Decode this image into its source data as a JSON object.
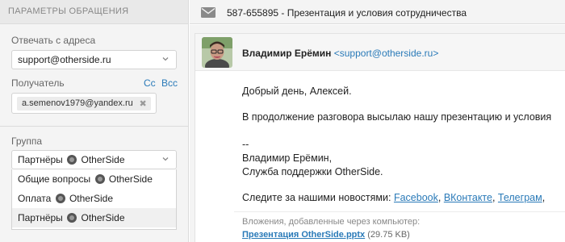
{
  "left": {
    "header": "ПАРАМЕТРЫ ОБРАЩЕНИЯ",
    "from_label": "Отвечать с адреса",
    "from_value": "support@otherside.ru",
    "recipient_label": "Получатель",
    "cc_label": "Cc",
    "bcc_label": "Bcc",
    "recipient_chip": "a.semenov1979@yandex.ru",
    "group_label": "Группа",
    "group_selected_prefix": "Партнёры",
    "group_selected_suffix": "OtherSide",
    "group_options": [
      {
        "prefix": "Общие вопросы",
        "suffix": "OtherSide"
      },
      {
        "prefix": "Оплата",
        "suffix": "OtherSide"
      },
      {
        "prefix": "Партнёры",
        "suffix": "OtherSide"
      }
    ]
  },
  "topbar": {
    "title": "587-655895 - Презентация и условия сотрудничества"
  },
  "message": {
    "sender_name": "Владимир Ерёмин",
    "sender_email": "<support@otherside.ru>",
    "greeting": "Добрый день, Алексей.",
    "line1": "В продолжение разговора высылаю нашу презентацию и условия",
    "sig_dash": "--",
    "sig_name": "Владимир Ерёмин,",
    "sig_team": "Служба поддержки OtherSide.",
    "follow_text": "Следите за нашими новостями:",
    "links": [
      "Facebook",
      "ВКонтакте",
      "Телеграм"
    ],
    "attach_label": "Вложения, добавленные через компьютер:",
    "attach_file": "Презентация OtherSide.pptx",
    "attach_size": "(29.75 KB)"
  },
  "colors": {
    "link": "#2a7ab8",
    "panel_bg": "#f4f4f4"
  },
  "icons": {
    "mail": "envelope-icon",
    "chevron": "chevron-down-icon",
    "remove": "close-icon",
    "logo": "otherside-logo-icon"
  }
}
